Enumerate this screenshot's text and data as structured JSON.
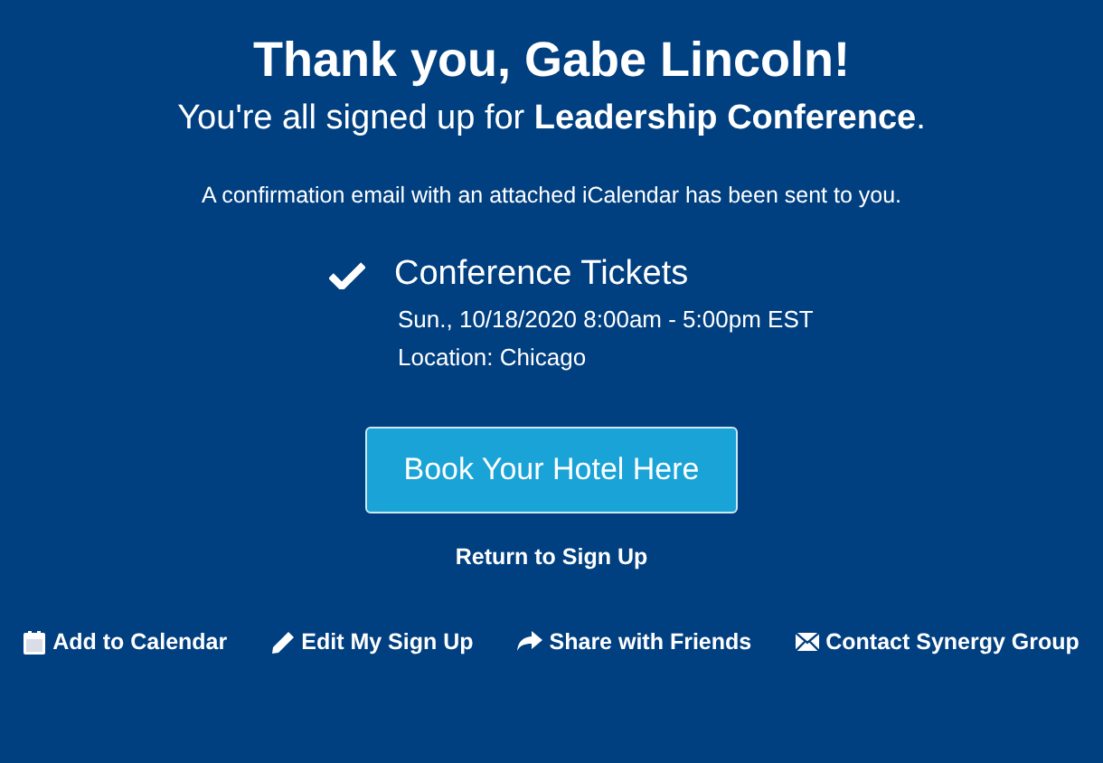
{
  "heading": "Thank you, Gabe Lincoln!",
  "subheading": "You're all signed up for **Leadership Conference**.",
  "note": "A confirmation email with an attached iCalendar has been sent to you.",
  "signup": {
    "title": "Conference Tickets",
    "checked": true,
    "date": "Sun., 10/18/2020 8:00am - 5:00pm EST",
    "location": "Location: Chicago"
  },
  "primary_button": "Book Your Hotel Here",
  "return_link": "Return to Sign Up",
  "actions": [
    {
      "kind": "calendar",
      "label": "Add to Calendar"
    },
    {
      "kind": "edit",
      "label": "Edit My Sign Up"
    },
    {
      "kind": "share",
      "label": "Share with Friends"
    },
    {
      "kind": "mail",
      "label": "Contact Synergy Group"
    }
  ]
}
